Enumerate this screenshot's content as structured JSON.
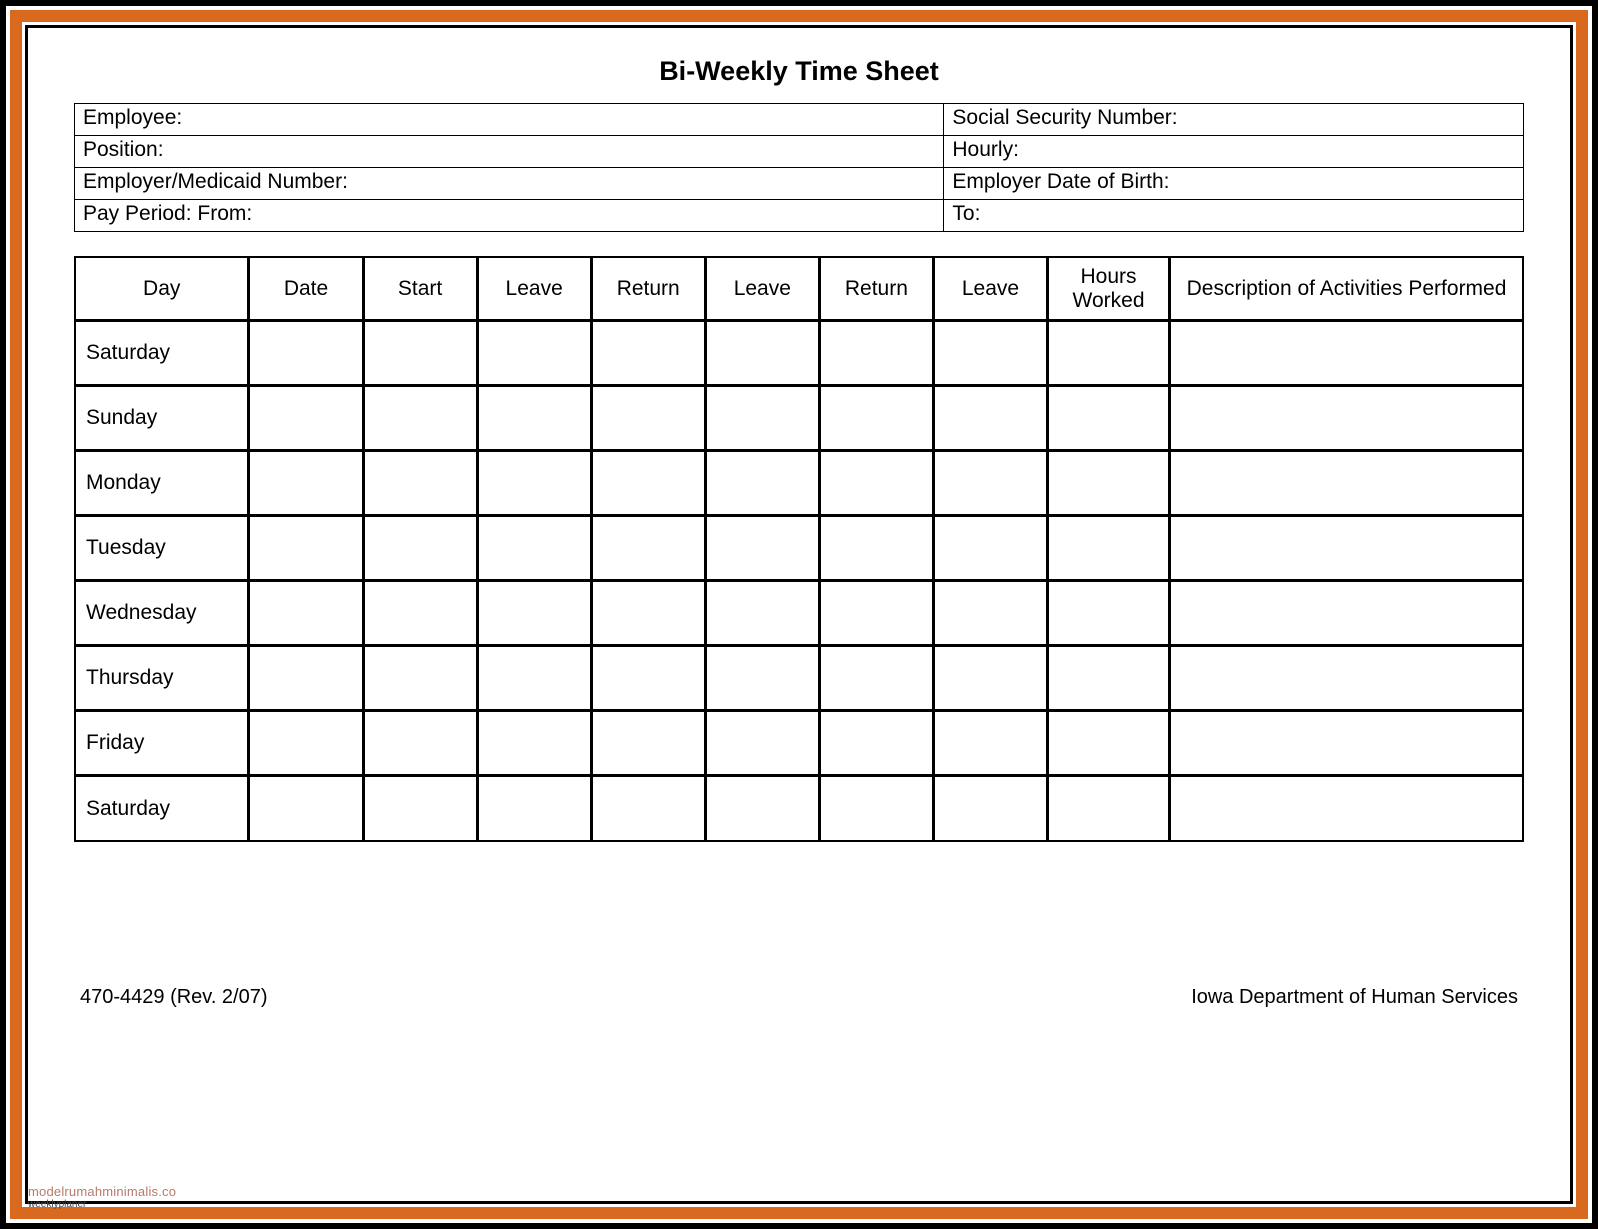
{
  "title": "Bi-Weekly Time Sheet",
  "info": {
    "employee_label": "Employee:",
    "ssn_label": "Social Security Number:",
    "position_label": "Position:",
    "hourly_label": "Hourly:",
    "employer_medicaid_label": "Employer/Medicaid Number:",
    "employer_dob_label": "Employer Date of Birth:",
    "pay_period_from_label": "Pay Period:  From:",
    "pay_period_to_label": "To:"
  },
  "columns": {
    "day": "Day",
    "date": "Date",
    "start": "Start",
    "leave1": "Leave",
    "return1": "Return",
    "leave2": "Leave",
    "return2": "Return",
    "leave3": "Leave",
    "hours_worked": "Hours Worked",
    "description": "Description of Activities Performed"
  },
  "days": [
    "Saturday",
    "Sunday",
    "Monday",
    "Tuesday",
    "Wednesday",
    "Thursday",
    "Friday",
    "Saturday"
  ],
  "footer": {
    "form_rev": "470-4429  (Rev. 2/07)",
    "agency": "Iowa Department of Human Services"
  },
  "watermark": "modelrumahminimalis.co",
  "watermark2": "weeklyplaner"
}
